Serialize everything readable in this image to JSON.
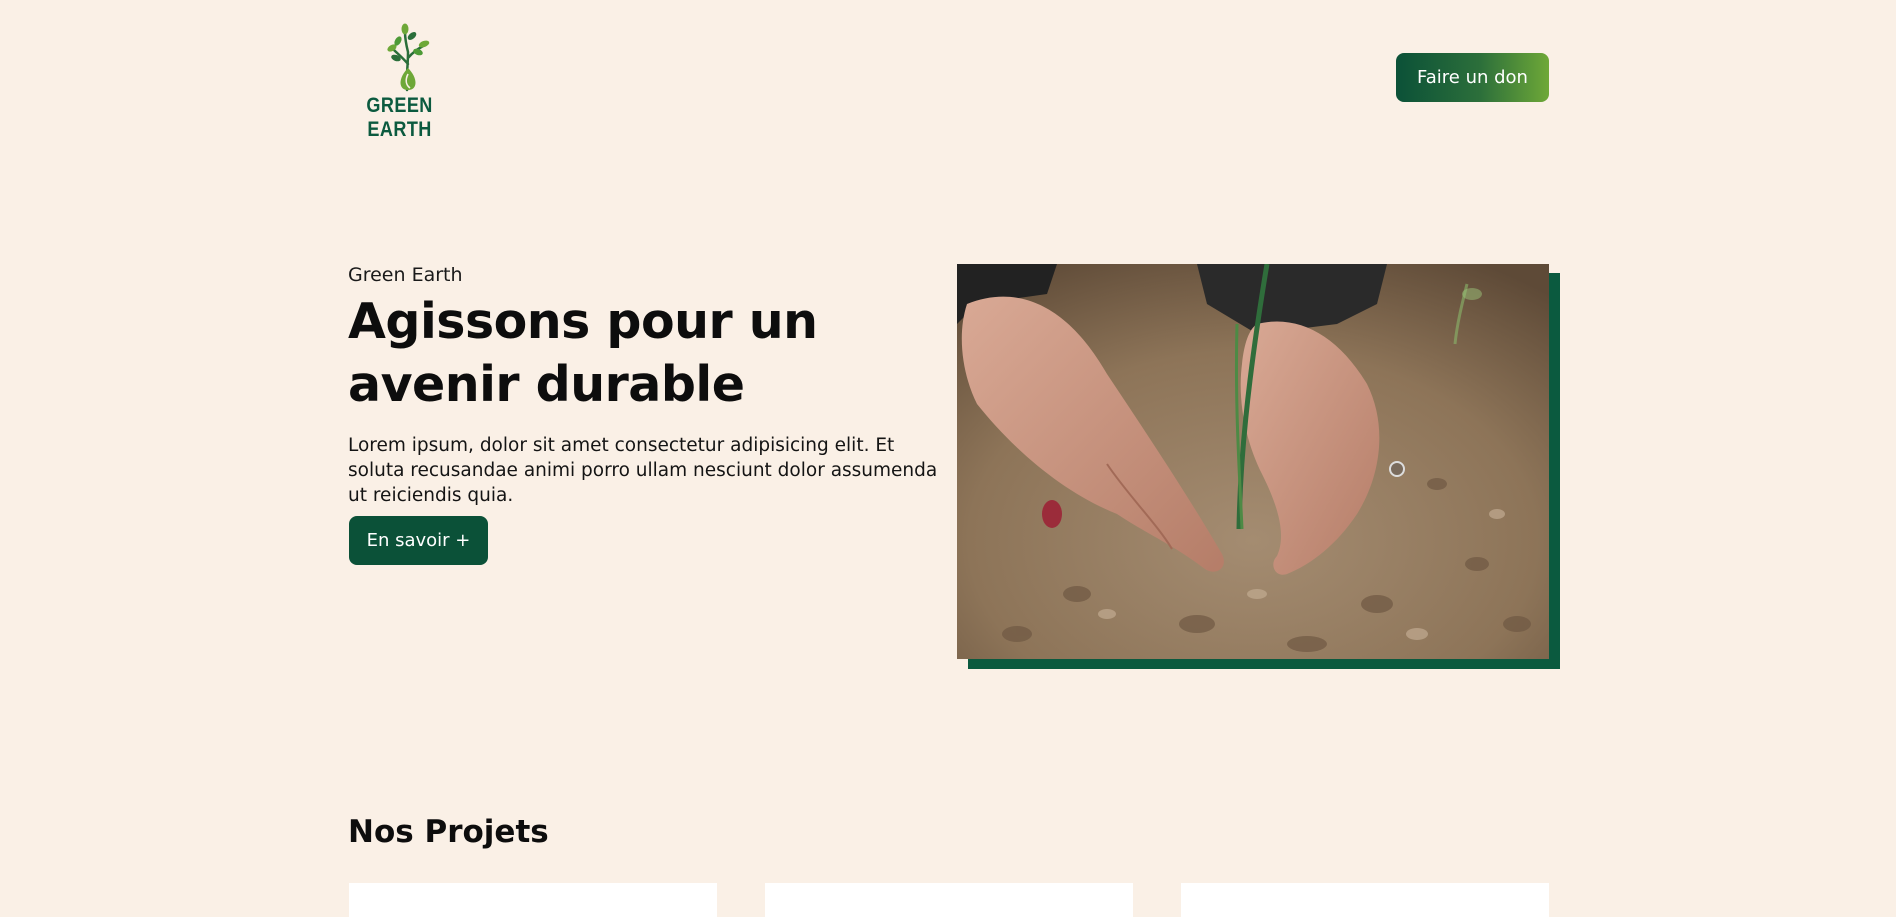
{
  "header": {
    "logo_text": "GREEN EARTH",
    "donate_label": "Faire un don"
  },
  "hero": {
    "eyebrow": "Green Earth",
    "title": "Agissons pour un avenir durable",
    "text": "Lorem ipsum, dolor sit amet consectetur adipisicing elit. Et soluta recusandae animi porro ullam nesciunt dolor assumenda ut reiciendis quia.",
    "cta_label": "En savoir +"
  },
  "projects": {
    "title": "Nos Projets"
  },
  "colors": {
    "background": "#faf0e6",
    "brand_dark": "#0b5138",
    "brand_light": "#6ea838",
    "image_shadow": "#0b5a3f"
  },
  "icons": {
    "logo": "sprout-tree-icon"
  }
}
